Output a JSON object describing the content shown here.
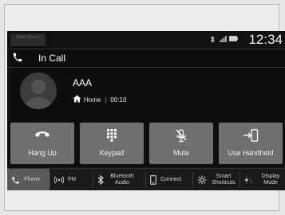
{
  "status_bar": {
    "audio_source_label": "Audio Source",
    "time": "12:34",
    "icons": [
      "bluetooth-icon",
      "signal-icon",
      "battery-icon"
    ]
  },
  "call": {
    "header_label": "In Call",
    "contact_name": "AAA",
    "number_type": "Home",
    "duration": "00:10"
  },
  "actions": [
    {
      "label": "Hang Up",
      "icon": "hang-up-icon"
    },
    {
      "label": "Keypad",
      "icon": "keypad-icon"
    },
    {
      "label": "Mute",
      "icon": "microphone-muted-icon"
    },
    {
      "label": "Use Handheld",
      "icon": "handheld-transfer-icon"
    }
  ],
  "nav": [
    {
      "label": "Phone",
      "icon": "phone-icon",
      "active": true
    },
    {
      "label": "FM",
      "icon": "radio-icon",
      "active": false
    },
    {
      "label": "Bluetooth Audio",
      "icon": "bluetooth-icon",
      "active": false
    },
    {
      "label": "Connect",
      "icon": "smartphone-icon",
      "active": false
    },
    {
      "label": "Smart Shortcuts",
      "icon": "shortcuts-icon",
      "active": false
    },
    {
      "label": "Display Mode",
      "icon": "display-mode-icon",
      "active": false
    }
  ],
  "colors": {
    "screen_bg": "#0e0e0e",
    "button_bg": "#6f6f6f",
    "active_nav_bg": "#5a5a5a",
    "text": "#ffffff"
  }
}
